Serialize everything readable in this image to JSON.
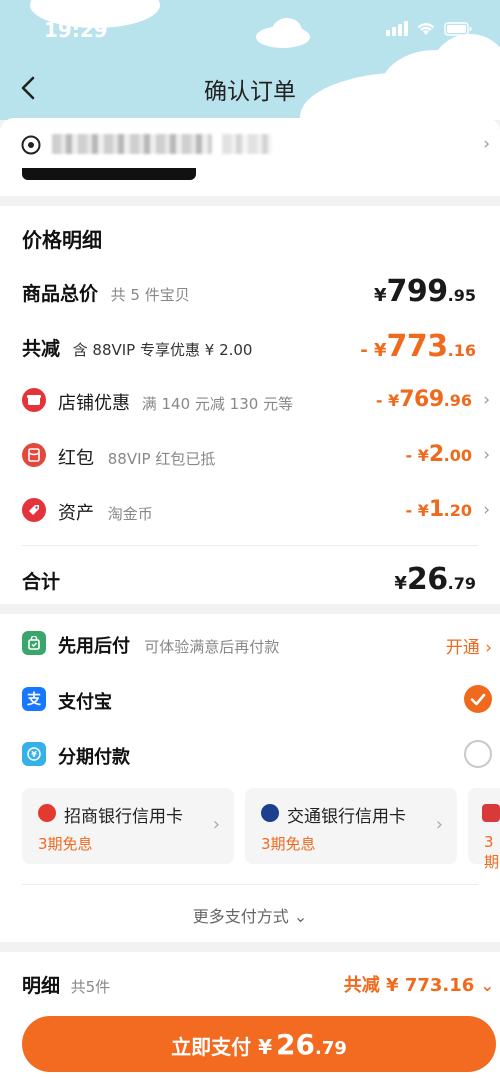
{
  "status": {
    "time": "19:29"
  },
  "header": {
    "title": "确认订单"
  },
  "address": {
    "arrow": "›"
  },
  "price_detail": {
    "section_title": "价格明细",
    "goods_total": {
      "label": "商品总价",
      "sub": "共 5 件宝贝",
      "symbol": "¥",
      "int": "799",
      "dec": ".95"
    },
    "total_discount": {
      "label": "共减",
      "sub": "含 88VIP 专享优惠 ¥ 2.00",
      "symbol": "- ¥",
      "int": "773",
      "dec": ".16"
    },
    "items": [
      {
        "label": "店铺优惠",
        "sub": "满 140 元减 130 元等",
        "symbol": "- ¥",
        "int": "769",
        "dec": ".96",
        "icon": "shop-icon"
      },
      {
        "label": "红包",
        "sub": "88VIP 红包已抵",
        "symbol": "- ¥",
        "int": "2",
        "dec": ".00",
        "icon": "red-packet-icon"
      },
      {
        "label": "资产",
        "sub": "淘金币",
        "symbol": "- ¥",
        "int": "1",
        "dec": ".20",
        "icon": "coin-tag-icon"
      }
    ],
    "sum": {
      "label": "合计",
      "symbol": "¥",
      "int": "26",
      "dec": ".79"
    }
  },
  "payment": {
    "pay_later": {
      "label": "先用后付",
      "sub": "可体验满意后再付款",
      "action": "开通 ›"
    },
    "alipay": {
      "label": "支付宝",
      "selected": true
    },
    "installment": {
      "label": "分期付款",
      "selected": false
    },
    "banks": [
      {
        "name": "招商银行信用卡",
        "free": "3期免息"
      },
      {
        "name": "交通银行信用卡",
        "free": "3期免息"
      },
      {
        "name": "",
        "free": "3期"
      }
    ],
    "more": "更多支付方式 ⌄"
  },
  "bottom": {
    "detail_label": "明细",
    "detail_sub": "共5件",
    "discount": "共减 ¥ 773.16",
    "pay_button": {
      "label": "立即支付 ¥",
      "int": "26",
      "dec": ".79"
    }
  },
  "colors": {
    "accent": "#f06a1e",
    "header_bg": "#b9e3ec",
    "alipay_blue": "#1677ff",
    "pay_later_green": "#3aa66b"
  }
}
